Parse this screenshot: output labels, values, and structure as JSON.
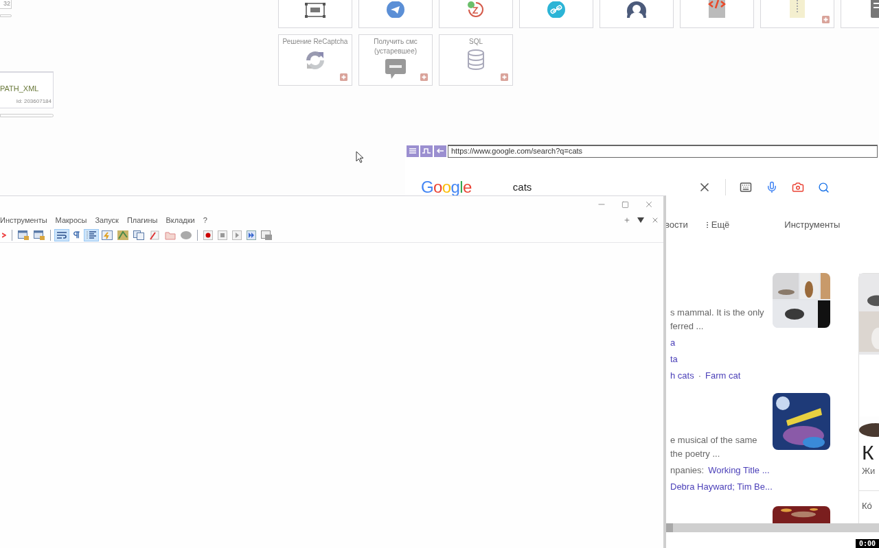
{
  "canvas_nodes": [
    {
      "kind": "stub",
      "title": "32"
    },
    {
      "kind": "node",
      "title": "PATH_XML",
      "id_text": "Id: 203607184"
    }
  ],
  "tiles_top": [
    {
      "kind": "txt",
      "add": false
    },
    {
      "kind": "telegram",
      "add": false
    },
    {
      "kind": "clock24",
      "add": false
    },
    {
      "kind": "link",
      "add": false
    },
    {
      "kind": "user",
      "add": false
    },
    {
      "kind": "code",
      "add": false
    },
    {
      "kind": "zip",
      "add": true
    },
    {
      "kind": "doc"
    }
  ],
  "tiles": [
    {
      "label": "Решение ReCaptcha",
      "kind": "recaptcha",
      "add": true
    },
    {
      "label": "Получить смс (устаревшее)",
      "kind": "sms",
      "add": true
    },
    {
      "label": "SQL",
      "kind": "database",
      "add": true
    }
  ],
  "url_bar": {
    "buttons": [
      {
        "kind": "menu"
      },
      {
        "kind": "pulse"
      },
      {
        "kind": "back"
      }
    ],
    "url": "https://www.google.com/search?q=cats"
  },
  "google": {
    "logo": "Google",
    "query": "cats",
    "tabs": [
      {
        "label": "вости",
        "kind": "tab"
      },
      {
        "label": "Ещё",
        "kind": "more"
      },
      {
        "label": "Инструменты",
        "kind": "tools"
      }
    ],
    "results": [
      {
        "lines": [
          [
            {
              "text": "s mammal. It is the only",
              "link": false
            }
          ],
          [
            {
              "text": "ferred ...",
              "link": false
            }
          ],
          [
            {
              "text": "a",
              "link": true
            }
          ],
          [
            {
              "text": "ta",
              "link": true
            }
          ],
          [
            {
              "text": "h cats",
              "link": true
            },
            {
              "text": "·",
              "link": false
            },
            {
              "text": "Farm cat",
              "link": true
            }
          ]
        ]
      },
      {
        "lines": [
          [
            {
              "text": "e musical of the same",
              "link": false
            }
          ],
          [
            {
              "text": "the poetry ...",
              "link": false
            }
          ],
          [
            {
              "text": "npanies: ",
              "link": false
            },
            {
              "text": "Working Title ...",
              "link": true
            }
          ],
          [
            {
              "text": "Debra Hayward; Tim Be...",
              "link": true
            }
          ]
        ]
      }
    ],
    "panel": {
      "heading": "К",
      "subheading": "Жи",
      "text": "Кó"
    }
  },
  "editor": {
    "menu": [
      "Инструменты",
      "Макросы",
      "Запуск",
      "Плагины",
      "Вкладки",
      "?"
    ],
    "toolbar": [
      {
        "kind": "cut-icon",
        "selected": false
      },
      {
        "kind": "separator"
      },
      {
        "kind": "lock-window",
        "selected": false
      },
      {
        "kind": "lock-window",
        "selected": false
      },
      {
        "kind": "separator"
      },
      {
        "kind": "wrap",
        "selected": true
      },
      {
        "kind": "pilcrow",
        "selected": false
      },
      {
        "kind": "indent",
        "selected": true
      },
      {
        "kind": "panel",
        "selected": false
      },
      {
        "kind": "map",
        "selected": false
      },
      {
        "kind": "copy",
        "selected": false
      },
      {
        "kind": "pen",
        "selected": false
      },
      {
        "kind": "folder",
        "selected": false
      },
      {
        "kind": "blob",
        "selected": false
      },
      {
        "kind": "separator"
      },
      {
        "kind": "record",
        "selected": false
      },
      {
        "kind": "stop",
        "selected": false
      },
      {
        "kind": "play",
        "selected": false
      },
      {
        "kind": "fastforward",
        "selected": false
      },
      {
        "kind": "grid",
        "selected": false
      }
    ]
  },
  "timer": "0:00"
}
